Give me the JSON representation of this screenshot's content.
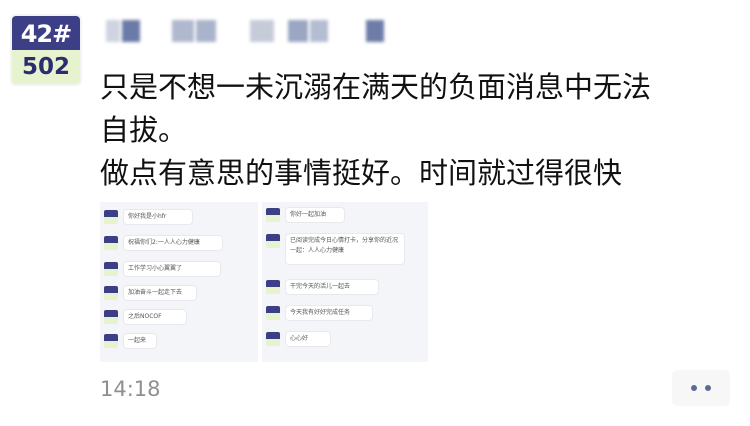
{
  "avatar": {
    "top_text": "42#",
    "bottom_text": "502",
    "top_color": "#3c3f86",
    "bottom_color": "#e7f3cf"
  },
  "nickname": {
    "blurred": true,
    "block_colors": [
      "#b8bfd2",
      "#6b7aa6",
      "#b0b8ce",
      "#a9b3cb",
      "#c6cbd8",
      "#9aa6c4",
      "#b4bdd1",
      "#6e7da8"
    ]
  },
  "post": {
    "lines": [
      "只是不想一未沉溺在满天的负面消息中无法",
      "自拔。",
      "做点有意思的事情挺好。时间就过得很快"
    ],
    "timestamp": "14:18"
  },
  "attachments": {
    "image_1": {
      "bubbles": [
        "你好我是小hfr",
        "祝福你们2:一人人心力健康",
        "工作学习小心翼翼了",
        "加油奋斗一起走下去",
        "之后NOCOF",
        "一起来"
      ]
    },
    "image_2": {
      "bubbles": [
        "你好一起加油",
        "已阅读完成今日心情打卡，分享你的近况一起：人人心力健康",
        "干完今天的活儿一起去",
        "今天我有好好完成任务",
        "心心好"
      ]
    }
  },
  "actions": {
    "more_icon": "more-dots-icon",
    "more_dot_color": "#5b6b92"
  }
}
